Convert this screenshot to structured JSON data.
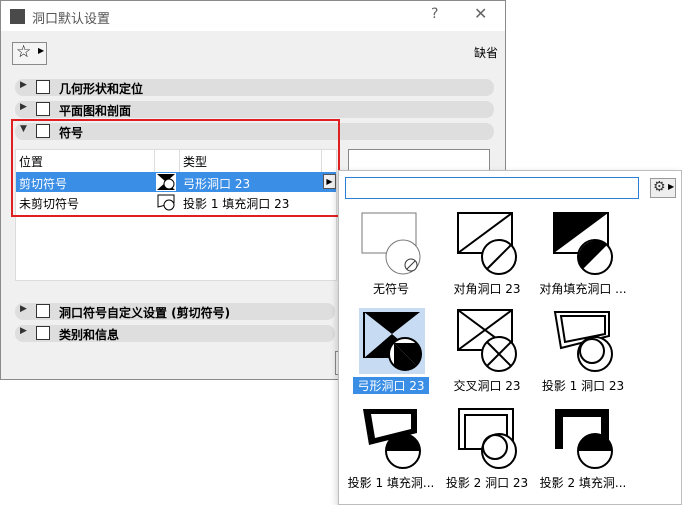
{
  "window": {
    "title": "洞口默认设置",
    "help": "?",
    "close": "✕"
  },
  "toolbar": {
    "defaults_label": "缺省"
  },
  "sections": {
    "geometry": "几何形状和定位",
    "plan": "平面图和剖面",
    "symbol": "符号",
    "custom": "洞口符号自定义设置 (剪切符号)",
    "category": "类别和信息"
  },
  "table": {
    "headers": {
      "position": "位置",
      "type": "类型"
    },
    "rows": [
      {
        "position": "剪切符号",
        "type": "弓形洞口 23",
        "selected": true
      },
      {
        "position": "未剪切符号",
        "type": "投影 1 填充洞口 23",
        "selected": false
      }
    ]
  },
  "popup": {
    "search_value": "",
    "items": [
      {
        "label": "无符号",
        "selected": false,
        "icon": "none"
      },
      {
        "label": "对角洞口 23",
        "selected": false,
        "icon": "diag"
      },
      {
        "label": "对角填充洞口 ...",
        "selected": false,
        "icon": "diagfill"
      },
      {
        "label": "弓形洞口 23",
        "selected": true,
        "icon": "bow"
      },
      {
        "label": "交叉洞口 23",
        "selected": false,
        "icon": "cross"
      },
      {
        "label": "投影 1 洞口 23",
        "selected": false,
        "icon": "proj1"
      },
      {
        "label": "投影 1 填充洞...",
        "selected": false,
        "icon": "proj1fill"
      },
      {
        "label": "投影 2 洞口 23",
        "selected": false,
        "icon": "proj2"
      },
      {
        "label": "投影 2 填充洞...",
        "selected": false,
        "icon": "proj2fill"
      }
    ]
  },
  "colors": {
    "selection": "#3a8ee6",
    "highlight_box": "#e02020",
    "focus": "#2d7fd6"
  }
}
